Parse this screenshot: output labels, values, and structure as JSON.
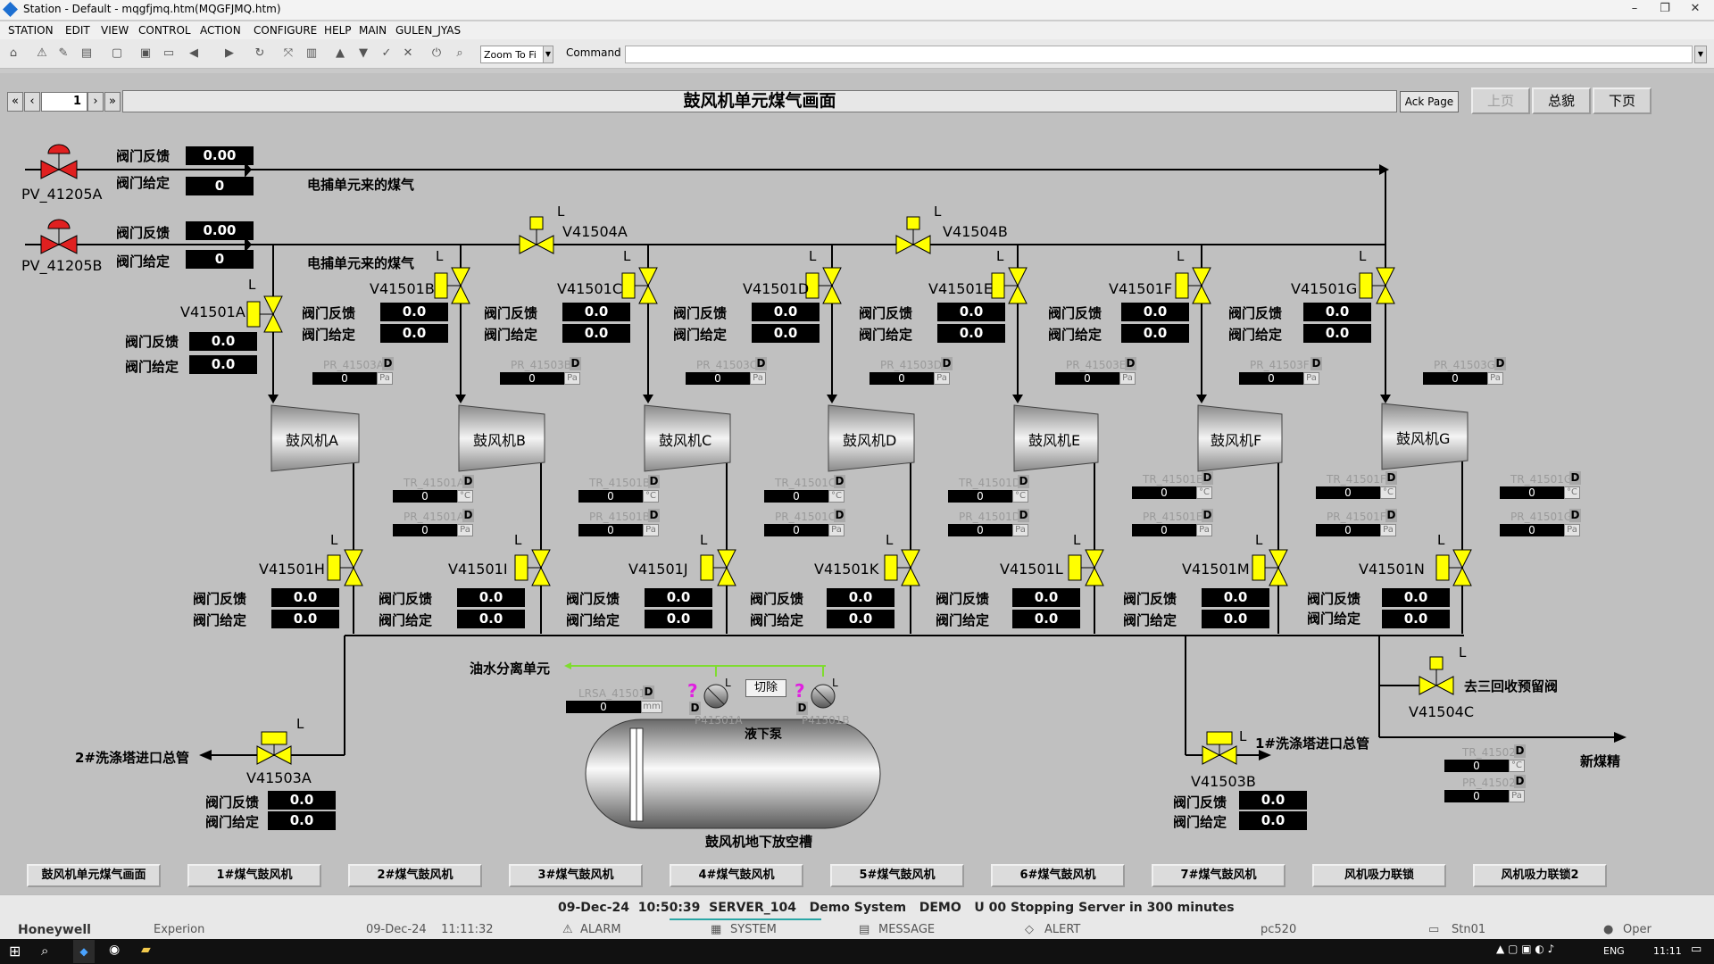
{
  "window": {
    "title": "Station - Default - mqgfjmq.htm(MQGFJMQ.htm)"
  },
  "menu": [
    "STATION",
    "EDIT",
    "VIEW",
    "CONTROL",
    "ACTION",
    "CONFIGURE",
    "HELP",
    "MAIN",
    "GULEN_JYAS"
  ],
  "toolbar": {
    "zoom": "Zoom To Fi",
    "command_label": "Command"
  },
  "header": {
    "page_number": "1",
    "title": "鼓风机单元煤气画面",
    "ack_page": "Ack Page",
    "prev_page": "上页",
    "overview": "总貌",
    "next_page": "下页"
  },
  "top_valves": {
    "pv_a": {
      "tag": "PV_41205A",
      "fb_label": "阀门反馈",
      "fb": "0.00",
      "sp_label": "阀门给定",
      "sp": "0",
      "line_label": "电捕单元来的煤气"
    },
    "pv_b": {
      "tag": "PV_41205B",
      "fb_label": "阀门反馈",
      "fb": "0.00",
      "sp_label": "阀门给定",
      "sp": "0",
      "line_label": "电捕单元来的煤气"
    }
  },
  "header_valves": {
    "a": "V41504A",
    "b": "V41504B",
    "mode": "L"
  },
  "inlet_valves": [
    {
      "tag": "V41501A",
      "mode": "L",
      "fb_label": "阀门反馈",
      "fb": "0.0",
      "sp_label": "阀门给定",
      "sp": "0.0",
      "pr": "PR_41503A",
      "pr_val": "0",
      "pr_unit": "Pa",
      "d": "D"
    },
    {
      "tag": "V41501B",
      "mode": "L",
      "fb_label": "阀门反馈",
      "fb": "0.0",
      "sp_label": "阀门给定",
      "sp": "0.0",
      "pr": "PR_41503B",
      "pr_val": "0",
      "pr_unit": "Pa",
      "d": "D"
    },
    {
      "tag": "V41501C",
      "mode": "L",
      "fb_label": "阀门反馈",
      "fb": "0.0",
      "sp_label": "阀门给定",
      "sp": "0.0",
      "pr": "PR_41503C",
      "pr_val": "0",
      "pr_unit": "Pa",
      "d": "D"
    },
    {
      "tag": "V41501D",
      "mode": "L",
      "fb_label": "阀门反馈",
      "fb": "0.0",
      "sp_label": "阀门给定",
      "sp": "0.0",
      "pr": "PR_41503D",
      "pr_val": "0",
      "pr_unit": "Pa",
      "d": "D"
    },
    {
      "tag": "V41501E",
      "mode": "L",
      "fb_label": "阀门反馈",
      "fb": "0.0",
      "sp_label": "阀门给定",
      "sp": "0.0",
      "pr": "PR_41503E",
      "pr_val": "0",
      "pr_unit": "Pa",
      "d": "D"
    },
    {
      "tag": "V41501F",
      "mode": "L",
      "fb_label": "阀门反馈",
      "fb": "0.0",
      "sp_label": "阀门给定",
      "sp": "0.0",
      "pr": "PR_41503F",
      "pr_val": "0",
      "pr_unit": "Pa",
      "d": "D"
    },
    {
      "tag": "V41501G",
      "mode": "L",
      "fb_label": "阀门反馈",
      "fb": "0.0",
      "sp_label": "阀门给定",
      "sp": "0.0",
      "pr": "PR_41503G",
      "pr_val": "0",
      "pr_unit": "Pa",
      "d": "D"
    }
  ],
  "blowers": [
    "鼓风机A",
    "鼓风机B",
    "鼓风机C",
    "鼓风机D",
    "鼓风机E",
    "鼓风机F",
    "鼓风机G"
  ],
  "outlet_instr": [
    {
      "tr": "TR_41501A",
      "tr_val": "0",
      "tr_unit": "°C",
      "pr": "PR_41501A",
      "pr_val": "0",
      "pr_unit": "Pa",
      "d": "D"
    },
    {
      "tr": "TR_41501B",
      "tr_val": "0",
      "tr_unit": "°C",
      "pr": "PR_41501B",
      "pr_val": "0",
      "pr_unit": "Pa",
      "d": "D"
    },
    {
      "tr": "TR_41501C",
      "tr_val": "0",
      "tr_unit": "°C",
      "pr": "PR_41501C",
      "pr_val": "0",
      "pr_unit": "Pa",
      "d": "D"
    },
    {
      "tr": "TR_41501D",
      "tr_val": "0",
      "tr_unit": "°C",
      "pr": "PR_41501D",
      "pr_val": "0",
      "pr_unit": "Pa",
      "d": "D"
    },
    {
      "tr": "TR_41501E",
      "tr_val": "0",
      "tr_unit": "°C",
      "pr": "PR_41501E",
      "pr_val": "0",
      "pr_unit": "Pa",
      "d": "D"
    },
    {
      "tr": "TR_41501F",
      "tr_val": "0",
      "tr_unit": "°C",
      "pr": "PR_41501F",
      "pr_val": "0",
      "pr_unit": "Pa",
      "d": "D"
    },
    {
      "tr": "TR_41501G",
      "tr_val": "0",
      "tr_unit": "°C",
      "pr": "PR_41501G",
      "pr_val": "0",
      "pr_unit": "Pa",
      "d": "D"
    }
  ],
  "outlet_valves": [
    {
      "tag": "V41501H",
      "mode": "L",
      "fb_label": "阀门反馈",
      "fb": "0.0",
      "sp_label": "阀门给定",
      "sp": "0.0"
    },
    {
      "tag": "V41501I",
      "mode": "L",
      "fb_label": "阀门反馈",
      "fb": "0.0",
      "sp_label": "阀门给定",
      "sp": "0.0"
    },
    {
      "tag": "V41501J",
      "mode": "L",
      "fb_label": "阀门反馈",
      "fb": "0.0",
      "sp_label": "阀门给定",
      "sp": "0.0"
    },
    {
      "tag": "V41501K",
      "mode": "L",
      "fb_label": "阀门反馈",
      "fb": "0.0",
      "sp_label": "阀门给定",
      "sp": "0.0"
    },
    {
      "tag": "V41501L",
      "mode": "L",
      "fb_label": "阀门反馈",
      "fb": "0.0",
      "sp_label": "阀门给定",
      "sp": "0.0"
    },
    {
      "tag": "V41501M",
      "mode": "L",
      "fb_label": "阀门反馈",
      "fb": "0.0",
      "sp_label": "阀门给定",
      "sp": "0.0"
    },
    {
      "tag": "V41501N",
      "mode": "L",
      "fb_label": "阀门反馈",
      "fb": "0.0",
      "sp_label": "阀门给定",
      "sp": "0.0"
    }
  ],
  "washer2": {
    "tag": "V41503A",
    "mode": "L",
    "line": "2#洗涤塔进口总管",
    "fb_label": "阀门反馈",
    "fb": "0.0",
    "sp_label": "阀门给定",
    "sp": "0.0"
  },
  "washer1": {
    "tag": "V41503B",
    "mode": "L",
    "line": "1#洗涤塔进口总管",
    "fb_label": "阀门反馈",
    "fb": "0.0",
    "sp_label": "阀门给定",
    "sp": "0.0"
  },
  "recovery": {
    "tag": "V41504C",
    "mode": "L",
    "line": "去三回收预留阀"
  },
  "new_gas": {
    "line": "新煤精",
    "tr": "TR_41502",
    "tr_val": "0",
    "tr_unit": "°C",
    "pr": "PR_41502",
    "pr_val": "0",
    "pr_unit": "Pa",
    "d": "D"
  },
  "tank": {
    "separator": "油水分离单元",
    "level": "LRSA_41501",
    "level_val": "0",
    "level_unit": "mm",
    "d": "D",
    "cut": "切除",
    "pump_a": "P41501A",
    "pump_b": "P41501B",
    "pump_label": "液下泵",
    "tank_label": "鼓风机地下放空槽",
    "q": "?",
    "mode": "L"
  },
  "bottom_buttons": [
    "鼓风机单元煤气画面",
    "1#煤气鼓风机",
    "2#煤气鼓风机",
    "3#煤气鼓风机",
    "4#煤气鼓风机",
    "5#煤气鼓风机",
    "6#煤气鼓风机",
    "7#煤气鼓风机",
    "风机吸力联锁",
    "风机吸力联锁2"
  ],
  "status": {
    "message": "09-Dec-24  10:50:39  SERVER_104   Demo System   DEMO   U 00 Stopping Server in 300 minutes",
    "brand": "Honeywell",
    "product": "Experion",
    "datetime": "09-Dec-24    11:11:32",
    "alarm": "ALARM",
    "system": "SYSTEM",
    "message_tab": "MESSAGE",
    "alert": "ALERT",
    "host": "pc520",
    "station": "Stn01",
    "user": "Oper"
  },
  "taskbar": {
    "lang": "ENG",
    "time": "11:11"
  },
  "colors": {
    "valve_red": "#e02020",
    "valve_yellow": "#ffff00",
    "background": "#c0c0c0",
    "green_line": "#7fdc30",
    "magenta": "#e020e0"
  }
}
